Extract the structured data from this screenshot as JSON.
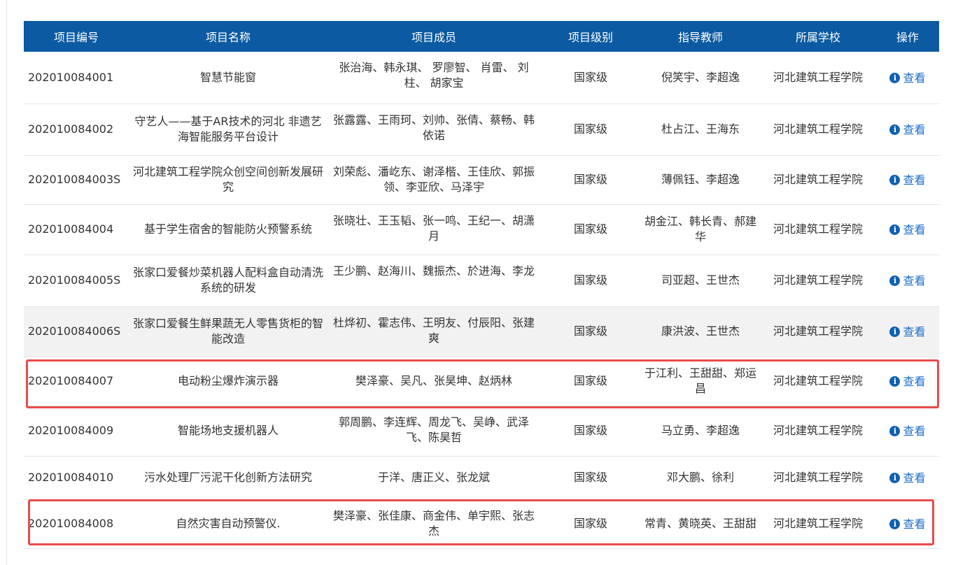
{
  "columns": {
    "id": "项目编号",
    "name": "项目名称",
    "members": "项目成员",
    "level": "项目级别",
    "advisor": "指导教师",
    "school": "所属学校",
    "action": "操作"
  },
  "colors": {
    "header_bg": "#0b5aa2",
    "link": "#1f6fc9",
    "highlight": "#e94b4b",
    "alt_row": "#f2f2f2"
  },
  "icons": {
    "view": "info-circle-icon"
  },
  "rows": [
    {
      "id": "202010084001",
      "name": "智慧节能窗",
      "members": "张治海、韩永琪、 罗廖智、 肖雷、 刘柱、 胡家宝",
      "level": "国家级",
      "advisor": "倪笑宇、李超逸",
      "school": "河北建筑工程学院",
      "action": "查看"
    },
    {
      "id": "202010084002",
      "name": "守艺人——基于AR技术的河北 非遗艺海智能服务平台设计",
      "members": "张露露、王雨珂、刘帅、张倩、蔡畅、韩依诺",
      "level": "国家级",
      "advisor": "杜占江、王海东",
      "school": "河北建筑工程学院",
      "action": "查看"
    },
    {
      "id": "202010084003S",
      "name": "河北建筑工程学院众创空间创新发展研究",
      "members": "刘荣彪、潘屹东、谢泽楷、王佳欣、郭振领、李亚欣、马泽宇",
      "level": "国家级",
      "advisor": "薄佩钰、李超逸",
      "school": "河北建筑工程学院",
      "action": "查看"
    },
    {
      "id": "202010084004",
      "name": "基于学生宿舍的智能防火预警系统",
      "members": "张晓壮、王玉韬、张一鸣、王纪一、胡潇月",
      "level": "国家级",
      "advisor": "胡金江、韩长青、郝建华",
      "school": "河北建筑工程学院",
      "action": "查看"
    },
    {
      "id": "202010084005S",
      "name": "张家口爱餐炒菜机器人配料盒自动清洗系统的研发",
      "members": "王少鹏、赵海川、魏振杰、於进海、李龙",
      "level": "国家级",
      "advisor": "司亚超、王世杰",
      "school": "河北建筑工程学院",
      "action": "查看"
    },
    {
      "id": "202010084006S",
      "name": "张家口爱餐生鲜果蔬无人零售货柜的智能改造",
      "members": "杜烨初、霍志伟、王明友、付辰阳、张建爽",
      "level": "国家级",
      "advisor": "康洪波、王世杰",
      "school": "河北建筑工程学院",
      "action": "查看"
    },
    {
      "id": "202010084007",
      "name": "电动粉尘爆炸演示器",
      "members": "樊泽豪、吴凡、张昊坤、赵炳林",
      "level": "国家级",
      "advisor": "于江利、王甜甜、郑运昌",
      "school": "河北建筑工程学院",
      "action": "查看"
    },
    {
      "id": "202010084009",
      "name": "智能场地支援机器人",
      "members": "郭周鹏、李连辉、周龙飞、吴峥、武泽飞、陈昊哲",
      "level": "国家级",
      "advisor": "马立勇、李超逸",
      "school": "河北建筑工程学院",
      "action": "查看"
    },
    {
      "id": "202010084010",
      "name": "污水处理厂污泥干化创新方法研究",
      "members": "于洋、唐正义、张龙斌",
      "level": "国家级",
      "advisor": "邓大鹏、徐利",
      "school": "河北建筑工程学院",
      "action": "查看"
    },
    {
      "id": "202010084008",
      "name": "自然灾害自动预警仪.",
      "members": "樊泽豪、张佳康、商金伟、单宇熙、张志杰",
      "level": "国家级",
      "advisor": "常青、黄晓英、王甜甜",
      "school": "河北建筑工程学院",
      "action": "查看"
    }
  ]
}
